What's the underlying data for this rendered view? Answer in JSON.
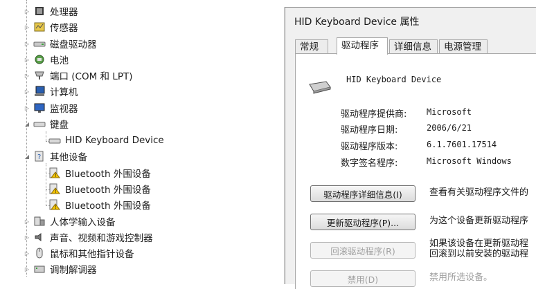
{
  "tree": {
    "items": [
      {
        "label": "处理器",
        "icon": "processor-icon"
      },
      {
        "label": "传感器",
        "icon": "sensor-icon"
      },
      {
        "label": "磁盘驱动器",
        "icon": "disk-drive-icon"
      },
      {
        "label": "电池",
        "icon": "battery-icon"
      },
      {
        "label": "端口 (COM 和 LPT)",
        "icon": "port-icon"
      },
      {
        "label": "计算机",
        "icon": "computer-icon"
      },
      {
        "label": "监视器",
        "icon": "monitor-icon"
      },
      {
        "label": "键盘",
        "icon": "keyboard-icon",
        "expanded": true
      },
      {
        "label": "HID Keyboard Device",
        "icon": "keyboard-device-icon",
        "child": true
      },
      {
        "label": "其他设备",
        "icon": "other-devices-icon",
        "expanded": true
      },
      {
        "label": "Bluetooth 外围设备",
        "icon": "warning-device-icon",
        "child": true
      },
      {
        "label": "Bluetooth 外围设备",
        "icon": "warning-device-icon",
        "child": true
      },
      {
        "label": "Bluetooth 外围设备",
        "icon": "warning-device-icon",
        "child": true
      },
      {
        "label": "人体学输入设备",
        "icon": "hid-icon"
      },
      {
        "label": "声音、视频和游戏控制器",
        "icon": "sound-icon"
      },
      {
        "label": "鼠标和其他指针设备",
        "icon": "mouse-icon"
      },
      {
        "label": "调制解调器",
        "icon": "modem-icon"
      }
    ]
  },
  "dialog": {
    "title": "HID Keyboard Device 属性",
    "tabs": [
      "常规",
      "驱动程序",
      "详细信息",
      "电源管理"
    ],
    "active_tab": "驱动程序",
    "device_name": "HID Keyboard Device",
    "fields": [
      {
        "label": "驱动程序提供商:",
        "value": "Microsoft"
      },
      {
        "label": "驱动程序日期:",
        "value": "2006/6/21"
      },
      {
        "label": "驱动程序版本:",
        "value": "6.1.7601.17514"
      },
      {
        "label": "数字签名程序:",
        "value": "Microsoft Windows"
      }
    ],
    "buttons": [
      {
        "label": "驱动程序详细信息(I)",
        "desc": [
          "查看有关驱动程序文件的"
        ],
        "enabled": true
      },
      {
        "label": "更新驱动程序(P)...",
        "desc": [
          "为这个设备更新驱动程序"
        ],
        "enabled": true
      },
      {
        "label": "回滚驱动程序(R)",
        "desc": [
          "如果该设备在更新驱动程",
          "回滚到以前安装的驱动程"
        ],
        "enabled": false
      },
      {
        "label": "禁用(D)",
        "desc": [
          "禁用所选设备。"
        ],
        "enabled": false
      }
    ]
  },
  "colors": {
    "dialog_bg": "#f0f0f0",
    "panel_bg": "#ffffff",
    "disabled_text": "#a0a0a0",
    "warning": "#f2c200"
  }
}
